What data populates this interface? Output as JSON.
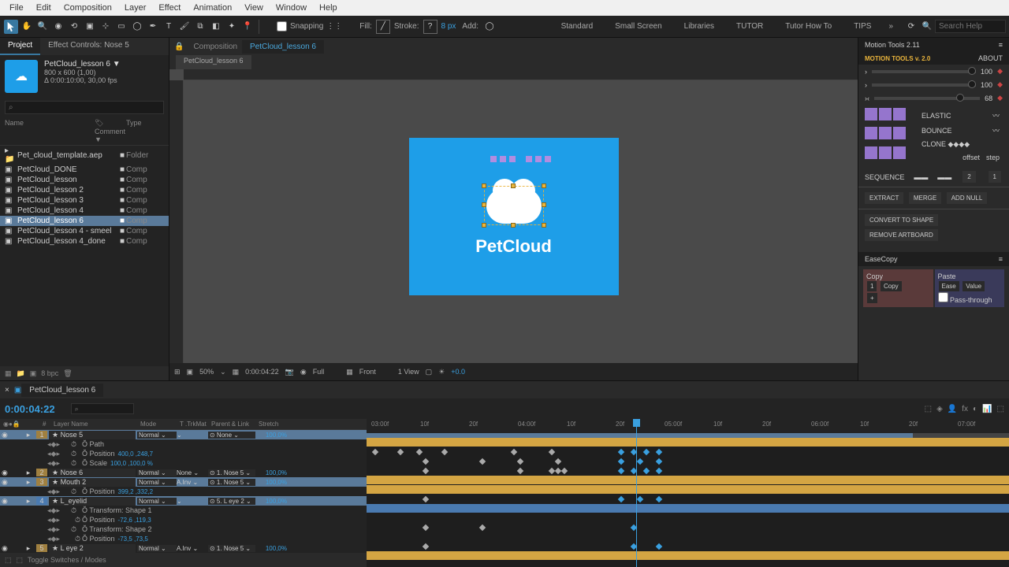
{
  "menu": [
    "File",
    "Edit",
    "Composition",
    "Layer",
    "Effect",
    "Animation",
    "View",
    "Window",
    "Help"
  ],
  "toolbar": {
    "snapping": "Snapping",
    "fill": "Fill:",
    "stroke": "Stroke:",
    "stroke_px": "8 px",
    "add": "Add: ",
    "workspaces": [
      "Standard",
      "Small Screen",
      "Libraries",
      "TUTOR",
      "Tutor How To",
      "TIPS"
    ],
    "search_ph": "Search Help"
  },
  "project": {
    "tab_project": "Project",
    "tab_effect": "Effect Controls: Nose 5",
    "comp_name": "PetCloud_lesson 6 ▼",
    "comp_size": "800 x 600 (1,00)",
    "comp_dur": "Δ 0:00:10:00, 30,00 fps",
    "cols": {
      "name": "Name",
      "comment": "Comment ▼",
      "type": "Type"
    },
    "items": [
      {
        "name": "Pet_cloud_template.aep",
        "type": "Folder",
        "folder": true
      },
      {
        "name": "PetCloud_DONE",
        "type": "Comp"
      },
      {
        "name": "PetCloud_lesson",
        "type": "Comp"
      },
      {
        "name": "PetCloud_lesson 2",
        "type": "Comp"
      },
      {
        "name": "PetCloud_lesson 3",
        "type": "Comp"
      },
      {
        "name": "PetCloud_lesson 4",
        "type": "Comp"
      },
      {
        "name": "PetCloud_lesson 6",
        "type": "Comp",
        "sel": true
      },
      {
        "name": "PetCloud_lesson 4 - smeel",
        "type": "Comp"
      },
      {
        "name": "PetCloud_lesson 4_done",
        "type": "Comp"
      }
    ]
  },
  "comp": {
    "panel_label": "Composition",
    "tab": "PetCloud_lesson 6",
    "subtab": "PetCloud_lesson 6",
    "logo": "PetCloud"
  },
  "viewer_footer": {
    "zoom": "50%",
    "time": "0:00:04:22",
    "res": "Full",
    "view_mode": "Front",
    "views": "1 View"
  },
  "right": {
    "panel": "Motion Tools 2.11",
    "title": "MOTION TOOLS v. 2.0",
    "about": "ABOUT",
    "v1": "100",
    "v2": "100",
    "v3": "68",
    "elastic": "ELASTIC",
    "bounce": "BOUNCE",
    "clone": "CLONE ◆◆◆◆",
    "offset": "offset",
    "step": "step",
    "sequence": "SEQUENCE",
    "sq1": "2",
    "sq2": "1",
    "extract": "EXTRACT",
    "merge": "MERGE",
    "addnull": "ADD NULL",
    "convert": "CONVERT TO SHAPE",
    "remove": "REMOVE ARTBOARD",
    "easecopy": "EaseCopy",
    "copy": "Copy",
    "copybtn": "Copy",
    "paste": "Paste",
    "ease": "Ease",
    "value": "Value",
    "pass": "Pass-through"
  },
  "timeline": {
    "tab": "PetCloud_lesson 6",
    "time": "0:00:04:22",
    "cols": {
      "layer": "Layer Name",
      "mode": "Mode",
      "trkmat": "T .TrkMat",
      "parent": "Parent & Link",
      "stretch": "Stretch"
    },
    "layers": [
      {
        "n": "1",
        "name": "Nose 5",
        "mode": "Normal",
        "parent": "None",
        "stretch": "100,0%",
        "sel": true,
        "color": "y"
      },
      {
        "prop": "Path",
        "pval": ""
      },
      {
        "prop": "Position",
        "pval": "400,0 ,248,7"
      },
      {
        "prop": "Scale",
        "pval": "100,0 ,100,0 %"
      },
      {
        "n": "2",
        "name": "Nose 6",
        "mode": "Normal",
        "trk": "None",
        "parent": "1. Nose 5",
        "stretch": "100,0%",
        "color": "y"
      },
      {
        "n": "3",
        "name": "Mouth 2",
        "mode": "Normal",
        "trk": "A.Inv",
        "parent": "1. Nose 5",
        "stretch": "100,0%",
        "sel": true,
        "color": "y"
      },
      {
        "prop": "Position",
        "pval": "399,2 ,332,2"
      },
      {
        "n": "4",
        "name": "L_eyelid",
        "mode": "Normal",
        "parent": "5. L eye 2",
        "stretch": "100,0%",
        "sel": true,
        "color": "b"
      },
      {
        "prop": "Transform: Shape 1"
      },
      {
        "prop": "Position",
        "pval": "-72,6 ,119,3",
        "indent": true
      },
      {
        "prop": "Transform: Shape 2"
      },
      {
        "prop": "Position",
        "pval": "-73,5 ,73,5",
        "indent": true
      },
      {
        "n": "5",
        "name": "L eye 2",
        "mode": "Normal",
        "trk": "A.Inv",
        "parent": "1. Nose 5",
        "stretch": "100,0%",
        "color": "y"
      }
    ],
    "ruler": [
      "03:00f",
      "10f",
      "20f",
      "04:00f",
      "10f",
      "20f",
      "05:00f",
      "10f",
      "20f",
      "06:00f",
      "10f",
      "20f",
      "07:00f"
    ],
    "toggle": "Toggle Switches / Modes"
  },
  "footer": {
    "bpc": "8 bpc"
  }
}
